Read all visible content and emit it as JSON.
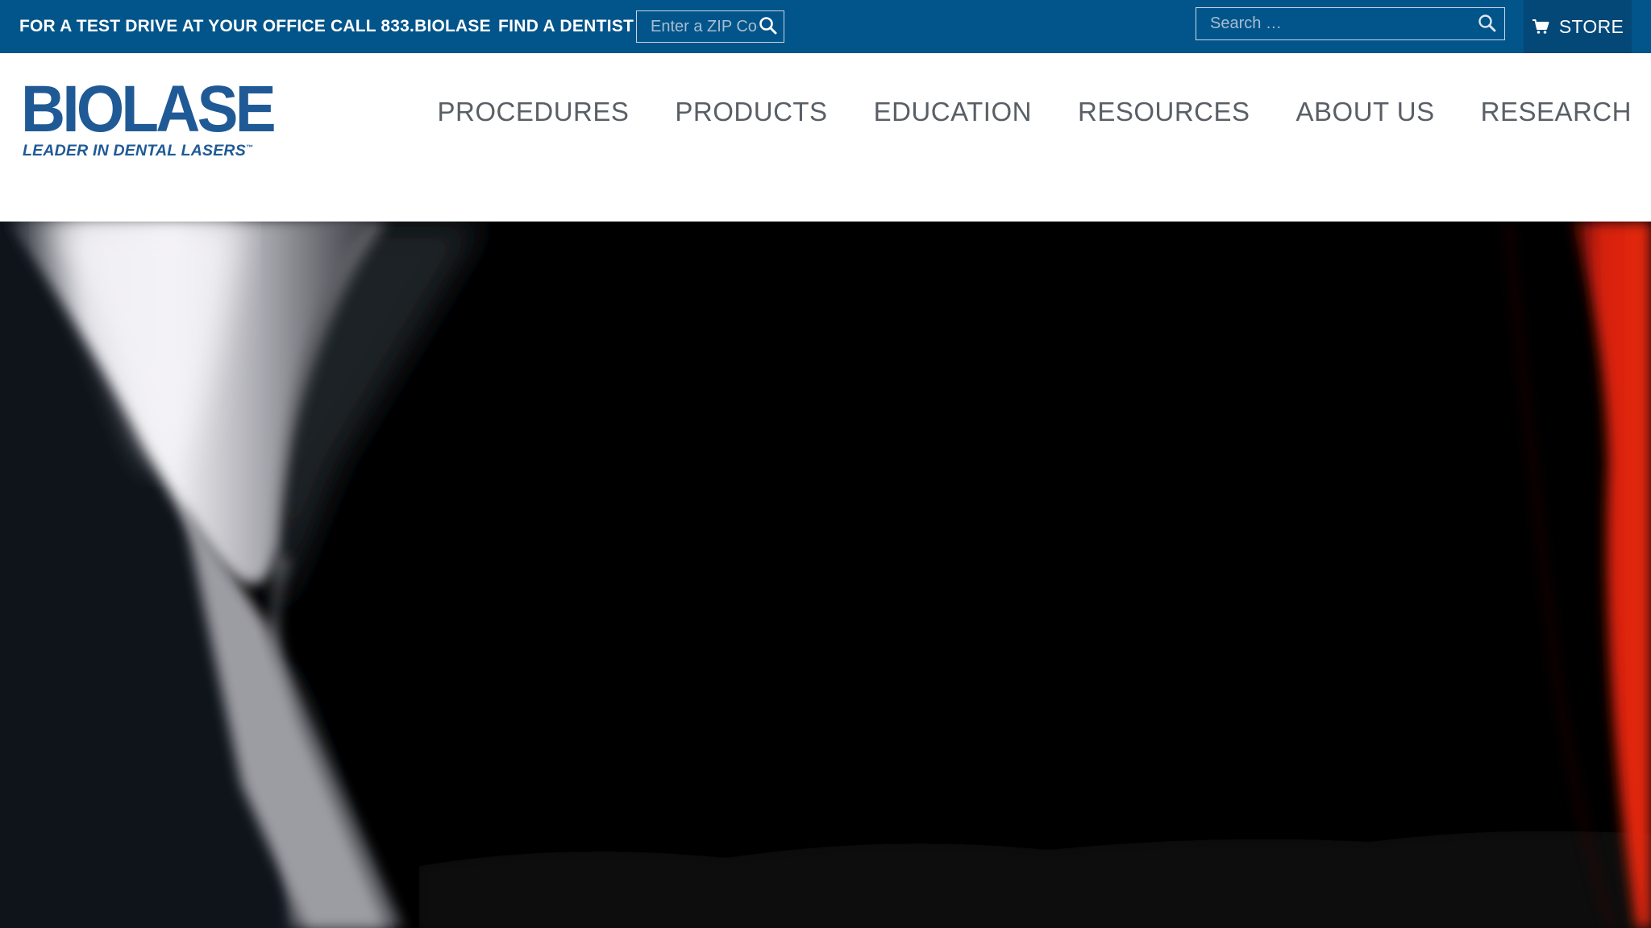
{
  "topbar": {
    "promo_text": "FOR A TEST DRIVE AT YOUR OFFICE CALL 833.BIOLASE",
    "find_dentist_label": "FIND A DENTIST",
    "zip_placeholder": "Enter a ZIP Code",
    "search_placeholder": "Search …",
    "store_label": "STORE",
    "zip_search_icon": "search-icon",
    "site_search_icon": "search-icon",
    "store_icon": "shopping-cart-icon"
  },
  "brand": {
    "wordmark": "BIOLASE",
    "tagline": "LEADER IN DENTAL LASERS",
    "trademark": "™"
  },
  "nav": {
    "items": [
      {
        "label": "PROCEDURES"
      },
      {
        "label": "PRODUCTS"
      },
      {
        "label": "EDUCATION"
      },
      {
        "label": "RESOURCES"
      },
      {
        "label": "ABOUT US"
      },
      {
        "label": "RESEARCH"
      }
    ]
  },
  "colors": {
    "topbar_bg": "#02558b",
    "store_bg": "#034877",
    "brand_blue": "#1f5a96",
    "nav_text": "#5a5f66",
    "hero_bg": "#000000",
    "hero_accent": "#e0250c"
  }
}
